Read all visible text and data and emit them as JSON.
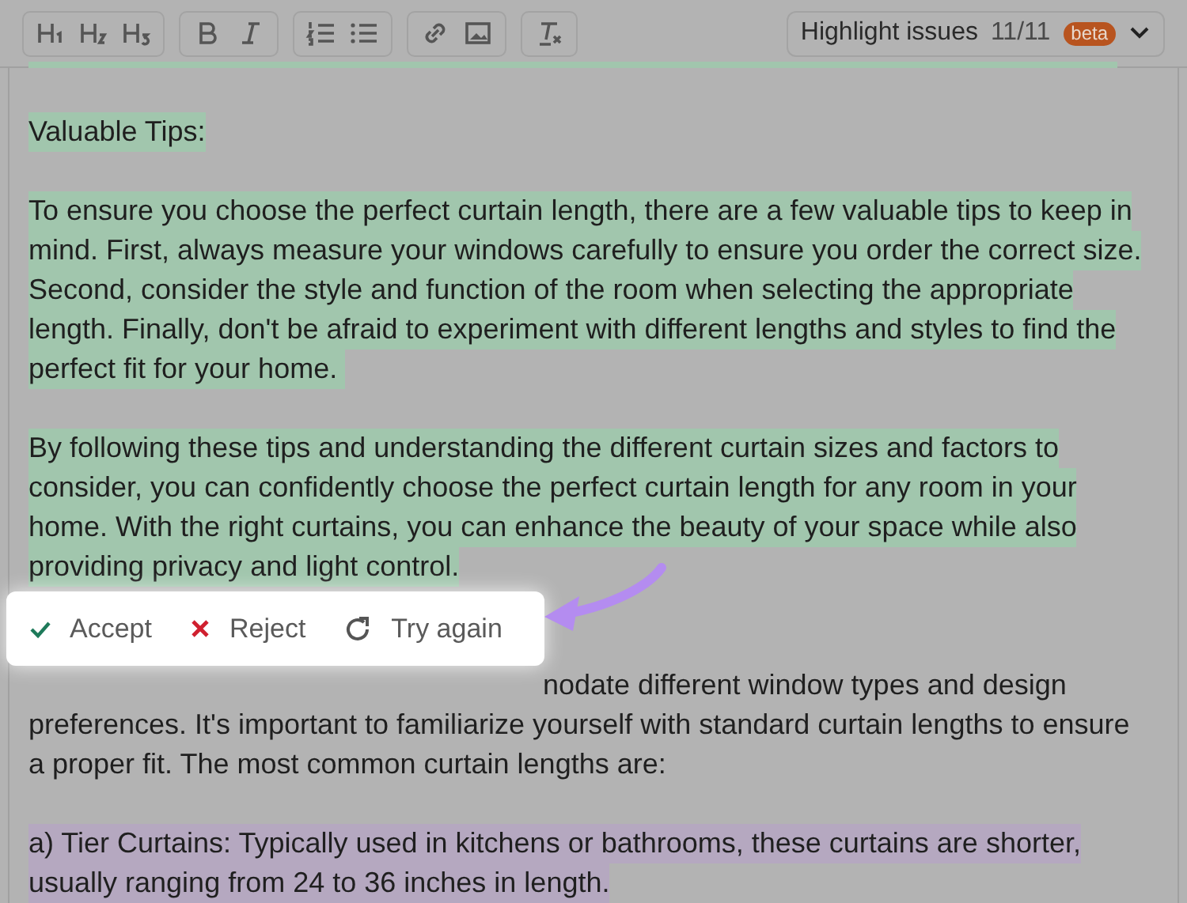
{
  "toolbar": {
    "groups": [
      [
        {
          "kind": "h1"
        },
        {
          "kind": "h2"
        },
        {
          "kind": "h3"
        }
      ],
      [
        {
          "kind": "bold"
        },
        {
          "kind": "italic"
        }
      ],
      [
        {
          "kind": "ordered-list"
        },
        {
          "kind": "bullet-list"
        }
      ],
      [
        {
          "kind": "link"
        },
        {
          "kind": "image"
        }
      ],
      [
        {
          "kind": "clear-format"
        }
      ]
    ],
    "highlight": {
      "label": "Highlight issues",
      "count": "11/11",
      "badge": "beta"
    }
  },
  "blocks": [
    {
      "kind": "highlight",
      "color": "#a1c6ad",
      "lines": [
        "Valuable Tips:"
      ]
    },
    {
      "kind": "highlight",
      "color": "#a1c6ad",
      "lines": [
        "To ensure you choose the perfect curtain length, there are a few valuable tips to keep in",
        "mind. First, always measure your windows carefully to ensure you order the correct size.",
        "Second, consider the style and function of the room when selecting the appropriate",
        "length. Finally, don't be afraid to experiment with different lengths and styles to find the",
        "perfect fit for your home. "
      ]
    },
    {
      "kind": "highlight",
      "color": "#a1c6ad",
      "lines": [
        "By following these tips and understanding the different curtain sizes and factors to",
        "consider, you can confidently choose the perfect curtain length for any room in your",
        "home. With the right curtains, you can enhance the beauty of your space while also",
        "providing privacy and light control."
      ]
    },
    {
      "kind": "covered",
      "lines": [
        "nodate different window types and design",
        "preferences. It's important to familiarize yourself with standard curtain lengths to ensure",
        "a proper fit. The most common curtain lengths are:"
      ]
    },
    {
      "kind": "highlight",
      "color": "#b5a8c0",
      "lines": [
        "a) Tier Curtains: Typically used in kitchens or bathrooms, these curtains are shorter,",
        "usually ranging from 24 to 36 inches in length."
      ]
    }
  ],
  "actions": [
    {
      "kind": "accept",
      "label": "Accept"
    },
    {
      "kind": "reject",
      "label": "Reject"
    },
    {
      "kind": "retry",
      "label": "Try again"
    }
  ]
}
